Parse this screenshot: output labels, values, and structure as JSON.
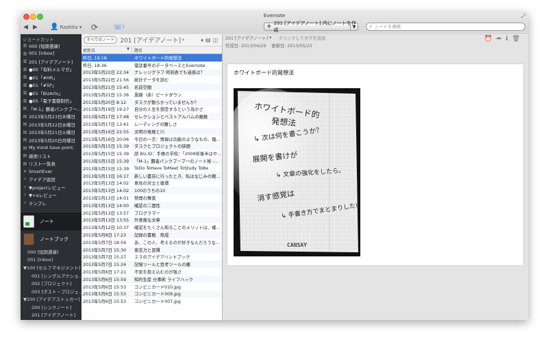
{
  "window": {
    "title": "Evernote"
  },
  "toolbar": {
    "account": "Rashita",
    "activity_count": "2",
    "new_note": "201 [アイデアノート] 内にノートを作成",
    "search_placeholder": "ノートを検索"
  },
  "sidebar": {
    "shortcuts_label": "ショートカット",
    "shortcuts": [
      "000 [短期選康]",
      "001 [inbox]",
      "201 [アイデアノート]",
      "●00「有料メルマガ」",
      "●01「#HR」",
      "●01「#SP」",
      "●01「BizArts」",
      "●05「電子書籍制作」",
      "「M-1」覇者パンクブー…",
      "2013年5月23日木曜日",
      "2013年5月22日水曜日",
      "2013年5月21日火曜日",
      "2013年5月20日月曜日",
      "My mind Save point.",
      "雑用リスト",
      "リスト一覧表",
      "SmartEver",
      "アイデア巡回",
      "▼projectレビュー",
      "▼+αレビュー",
      "テンプレ"
    ],
    "notes_label": "ノート",
    "notebooks_label": "ノートブック",
    "notebooks": [
      "000 [短期選康]",
      "001 [inbox]",
      "▼100 [セルフマネジメント]",
      "001 [シングルアクショ…",
      "002 [プロジェクト]",
      "003 [ポスト・プロジェ…",
      "▼200 [アイデアストッカー]",
      "200 [シンクノート]",
      "201 [アイデアノート]",
      "202 [アカウントアイデア…"
    ]
  },
  "notelist": {
    "all_notes": "すべてのノート",
    "notebook_name": "201 [アイデアノート]",
    "col_date": "更新日",
    "col_title": "題名",
    "rows": [
      {
        "date": "昨日, 19:18",
        "title": "ホワイトボード的発想法"
      },
      {
        "date": "昨日, 18:36",
        "title": "電話番号のデータベースとEvernote"
      },
      {
        "date": "2013年5月22日 22:34",
        "title": "ナレッジグラフ 時刻表でも迷惑は？"
      },
      {
        "date": "2013年5月22日 21:56",
        "title": "統計データを読む"
      },
      {
        "date": "2013年5月21日 15:45",
        "title": "名前空間"
      },
      {
        "date": "2013年5月21日 15:36",
        "title": "黒線（赤）ピートダウン"
      },
      {
        "date": "2013年5月20日 8:12",
        "title": "タスクが散らかっていませんか？"
      },
      {
        "date": "2013年5月19日 19:27",
        "title": "自分の人生を想定するという為かさ"
      },
      {
        "date": "2013年5月17日 17:48",
        "title": "セレクションとベストアルバムの類推"
      },
      {
        "date": "2013年5月17日 13:41",
        "title": "レーディングの難しさ"
      },
      {
        "date": "2013年5月16日 22:55",
        "title": "文明の発展と川"
      },
      {
        "date": "2013年5月16日 20:06",
        "title": "今日の一言：情報は功能のようなもの、鍛…"
      },
      {
        "date": "2013年5月15日 15:39",
        "title": "タスクとプロジェクトの狭間"
      },
      {
        "date": "2013年5月15日 15:39",
        "title": "読 Biz.ID：手帳の学校：「2009年後半はや…"
      },
      {
        "date": "2013年5月15日 15:39",
        "title": "「M-1」覇者パンクブーブーのノート術 -…"
      },
      {
        "date": "2013年5月15日 15:39",
        "title": "ToDo ToHave ToMeet ToStudy ToBe"
      },
      {
        "date": "2013年5月13日 16:17",
        "title": "新しい書店に行ったとき、私はなじみの棚…"
      },
      {
        "date": "2013年5月13日 14:02",
        "title": "意見の対立と循環"
      },
      {
        "date": "2013年5月13日 14:02",
        "title": "100のうちの10"
      },
      {
        "date": "2013年5月13日 14:01",
        "title": "禁煙の舞害"
      },
      {
        "date": "2013年5月13日 14:00",
        "title": "確認の二面性"
      },
      {
        "date": "2013年5月13日 13:57",
        "title": "プログラマー"
      },
      {
        "date": "2013年5月13日 13:55",
        "title": "外食風な文章"
      },
      {
        "date": "2013年5月12日 10:37",
        "title": "確認をたくさん知ることのメリットは、確…"
      },
      {
        "date": "2013年5月8日 17:23",
        "title": "記録の書概　熟成"
      },
      {
        "date": "2013年5月7日 18:59",
        "title": "あ、この人、考えるのが好きなんだろうな…"
      },
      {
        "date": "2013年5月7日 15:30",
        "title": "意志力と習慣"
      },
      {
        "date": "2013年5月7日 15:27",
        "title": "２３のアイデアハンドブック"
      },
      {
        "date": "2013年5月7日 15:24",
        "title": "記憶ツールと思考ツールの塵"
      },
      {
        "date": "2013年5月6日 17:21",
        "title": "不安を抱え込むのが強さ"
      },
      {
        "date": "2013年5月6日 15:59",
        "title": "知的生産 仕事術 ライフハック"
      },
      {
        "date": "2013年5月6日 15:53",
        "title": "コンピニカード010.jpg"
      },
      {
        "date": "2013年5月6日 15:53",
        "title": "コンピニカード009.jpg"
      },
      {
        "date": "2013年5月6日 15:53",
        "title": "コンピニカード007.jpg"
      }
    ]
  },
  "detail": {
    "notebook": "201 [アイデアノート]",
    "tag_prompt": "クリックしてタグを追加",
    "created": "作成日: 2013/04/29",
    "updated": "更新日: 2013/05/23",
    "title": "ホワイトボード的発想法",
    "handwriting": [
      "ホワイトボード的",
      "発想法",
      "↳ 次は何を書こうか？",
      "展開を書けが",
      "↳ 文章の強化をしたら。",
      "消す感覚は",
      "↳ 手書き方でまとまりしたい。"
    ],
    "brand": "CANSAY"
  }
}
